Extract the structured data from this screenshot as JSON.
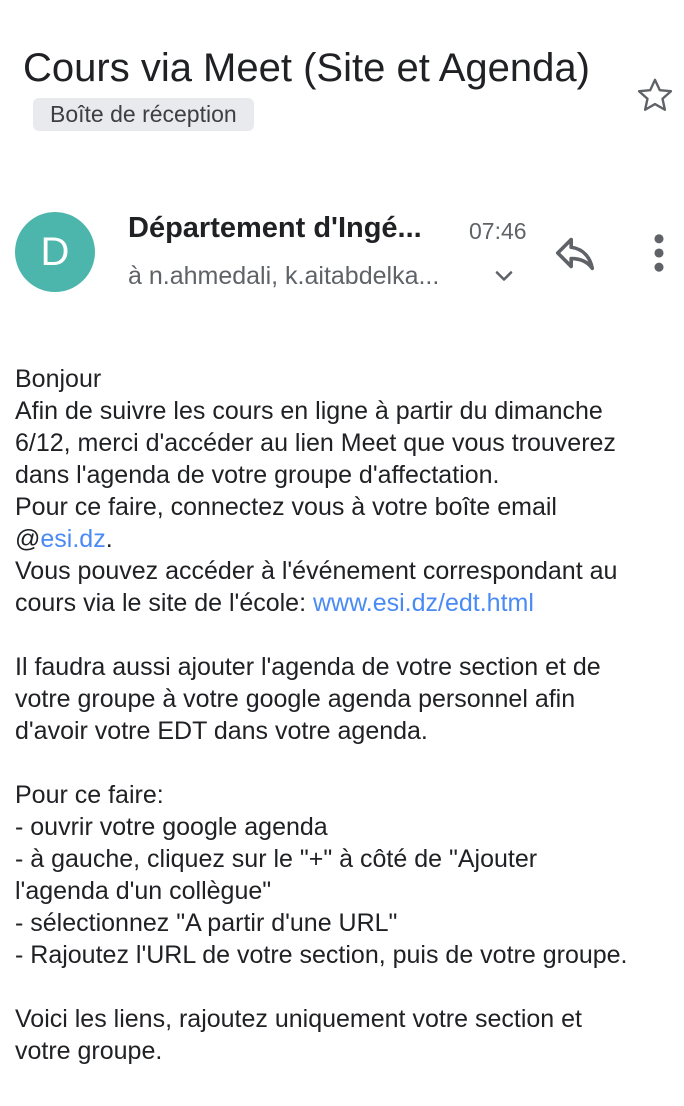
{
  "email": {
    "subject": "Cours via Meet (Site et Agenda)",
    "label": "Boîte de réception",
    "sender": {
      "avatar_letter": "D",
      "avatar_color": "#4db6ac",
      "name": "Département d'Ingé...",
      "time": "07:46",
      "recipients": "à n.ahmedali, k.aitabdelka..."
    },
    "icons": {
      "star": "star-outline-icon",
      "chevron": "chevron-down-icon",
      "reply": "reply-icon",
      "more": "more-vert-icon"
    },
    "colors": {
      "link": "#4a8af4",
      "chip_bg": "#e8eaed"
    },
    "body": {
      "line1": "Bonjour",
      "line2": "Afin de suivre les cours en ligne à partir du dimanche",
      "line3": "6/12, merci d'accéder au lien Meet que vous trouverez",
      "line4": "dans l'agenda de votre groupe d'affectation.",
      "line5": "Pour ce faire, connectez vous à votre boîte email",
      "line6_prefix": "@",
      "line6_link": "esi.dz",
      "line6_suffix": ".",
      "line7": "Vous pouvez accéder à l'événement correspondant au",
      "line8_prefix": "cours via le site de l'école: ",
      "line8_link": "www.esi.dz/edt.html",
      "line9": "Il faudra aussi ajouter l'agenda de votre section et de",
      "line10": "votre groupe à votre google agenda personnel afin",
      "line11": "d'avoir votre EDT dans votre agenda.",
      "line12": "Pour ce faire:",
      "line13": "- ouvrir votre google agenda",
      "line14": "- à gauche, cliquez sur le \"+\" à côté de \"Ajouter",
      "line15": "l'agenda d'un collègue\"",
      "line16": "- sélectionnez \"A partir d'une URL\"",
      "line17": "- Rajoutez l'URL de votre section, puis de votre groupe.",
      "line18": "Voici les liens, rajoutez uniquement votre section et",
      "line19": "votre groupe."
    }
  }
}
